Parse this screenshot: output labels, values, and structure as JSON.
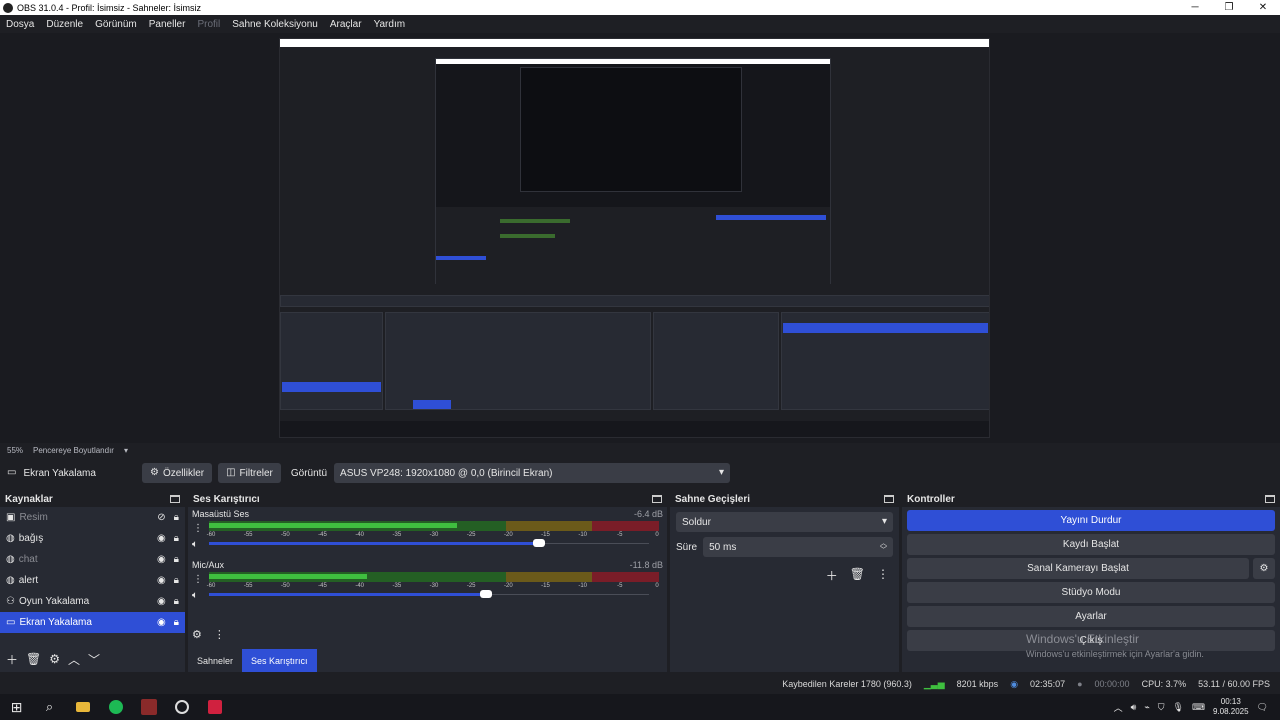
{
  "window": {
    "title": "OBS 31.0.4 - Profil: İsimsiz - Sahneler: İsimsiz",
    "minimize": "─",
    "restore": "❐",
    "close": "✕"
  },
  "menu": {
    "items": [
      "Dosya",
      "Düzenle",
      "Görünüm",
      "Paneller",
      "Profil",
      "Sahne Koleksiyonu",
      "Araçlar",
      "Yardım"
    ]
  },
  "zoom": {
    "percent": "55%",
    "mode": "Pencereye Boyutlandır"
  },
  "source_bar": {
    "current_source": "Ekran Yakalama",
    "properties": "Özellikler",
    "filters": "Filtreler",
    "display_label": "Görüntü",
    "display_value": "ASUS VP248: 1920x1080 @ 0,0 (Birincil Ekran)"
  },
  "sources": {
    "title": "Kaynaklar",
    "items": [
      {
        "name": "Resim"
      },
      {
        "name": "bağış"
      },
      {
        "name": "chat"
      },
      {
        "name": "alert"
      },
      {
        "name": "Oyun Yakalama"
      },
      {
        "name": "Ekran Yakalama"
      }
    ]
  },
  "mixer": {
    "title": "Ses Karıştırıcı",
    "channels": [
      {
        "name": "Masaüstü Ses",
        "db": "-6.4 dB",
        "level": 0.55,
        "volume": 0.75
      },
      {
        "name": "Mic/Aux",
        "db": "-11.8 dB",
        "level": 0.35,
        "volume": 0.63
      }
    ],
    "ticks": [
      "-60",
      "-55",
      "-50",
      "-45",
      "-40",
      "-35",
      "-30",
      "-25",
      "-20",
      "-15",
      "-10",
      "-5",
      "0"
    ],
    "tabs": [
      "Sahneler",
      "Ses Karıştırıcı"
    ]
  },
  "transitions": {
    "title": "Sahne Geçişleri",
    "type": "Soldur",
    "duration_label": "Süre",
    "duration_value": "50 ms"
  },
  "controls": {
    "title": "Kontroller",
    "stop_stream": "Yayını Durdur",
    "start_record": "Kaydı Başlat",
    "virtual_cam": "Sanal Kamerayı Başlat",
    "studio_mode": "Stüdyo Modu",
    "settings": "Ayarlar",
    "exit": "Çıkış"
  },
  "watermark": {
    "line1": "Windows'u Etkinleştir",
    "line2": "Windows'u etkinleştirmek için Ayarlar'a gidin."
  },
  "status": {
    "dropped": "Kaybedilen Kareler 1780 (960.3)",
    "bitrate": "8201 kbps",
    "stream_time": "02:35:07",
    "rec_time": "00:00:00",
    "cpu": "CPU: 3.7%",
    "fps": "53.11 / 60.00 FPS"
  },
  "taskbar": {
    "time": "00:13",
    "date": "9.08.2025"
  },
  "colors": {
    "accent": "#2f4fd6",
    "panel": "#272a33",
    "bg": "#1e1f24",
    "meter_green": "#3fbf3f",
    "meter_yellow": "#c9a227",
    "meter_red": "#c8283c"
  }
}
